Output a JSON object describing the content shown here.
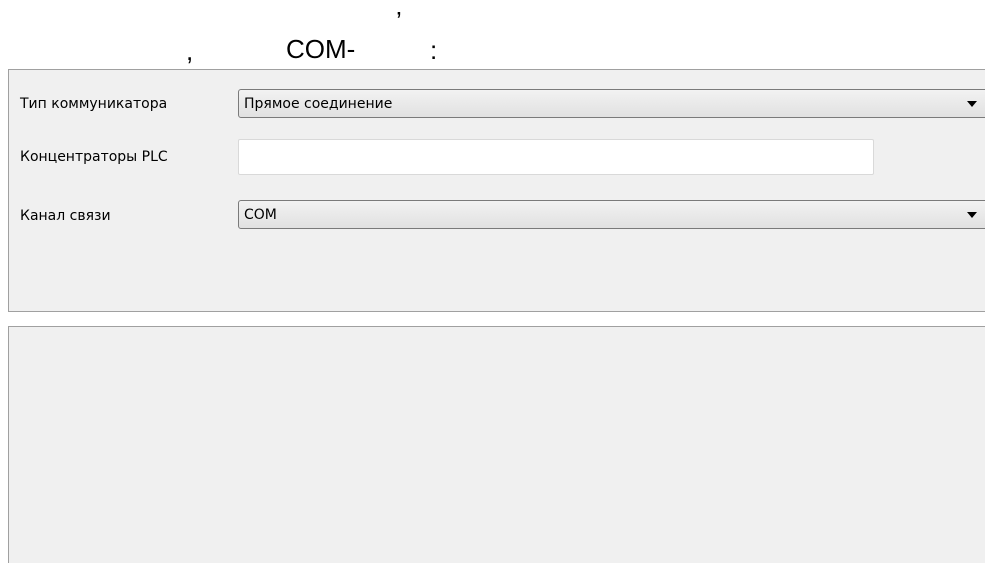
{
  "heading": {
    "frag1": ",",
    "frag2": "COM-",
    "frag3": "’",
    "frag4": ":"
  },
  "settings": {
    "communicator_type": {
      "label": "Тип коммуникатора",
      "value": "Прямое соединение",
      "icon": "chevron-down-icon"
    },
    "plc_concentrators": {
      "label": "Концентраторы PLC",
      "value": ""
    },
    "channel": {
      "label": "Канал связи",
      "value": "COM",
      "icon": "chevron-down-icon"
    }
  },
  "colors": {
    "panel_bg": "#f0f0f0",
    "border": "#a0a0a0",
    "text": "#000000"
  }
}
